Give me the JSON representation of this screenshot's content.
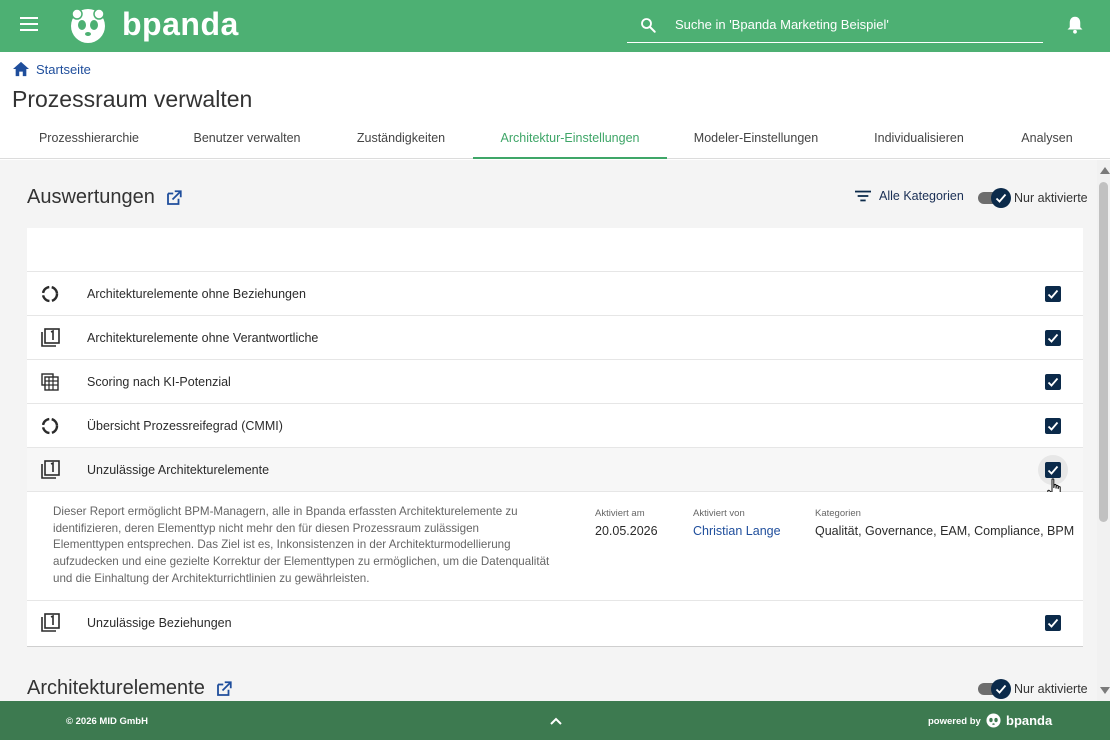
{
  "header": {
    "logo_text": "bpanda",
    "search_placeholder": "Suche in 'Bpanda Marketing Beispiel'"
  },
  "breadcrumb": {
    "home": "Startseite"
  },
  "page_title": "Prozessraum verwalten",
  "tabs": [
    {
      "label": "Prozesshierarchie"
    },
    {
      "label": "Benutzer verwalten"
    },
    {
      "label": "Zuständigkeiten"
    },
    {
      "label": "Architektur-Einstellungen",
      "active": true
    },
    {
      "label": "Modeler-Einstellungen"
    },
    {
      "label": "Individualisieren"
    },
    {
      "label": "Analysen"
    }
  ],
  "auswertungen": {
    "title": "Auswertungen",
    "filter_label": "Alle Kategorien",
    "toggle_label": "Nur aktivierte",
    "rows": [
      {
        "label": "Architekturelemente ohne Beziehungen",
        "icon": "donut-chart-icon",
        "checked": true
      },
      {
        "label": "Architekturelemente ohne Verantwortliche",
        "icon": "report-list-icon",
        "checked": true
      },
      {
        "label": "Scoring nach KI-Potenzial",
        "icon": "table-grid-icon",
        "checked": true
      },
      {
        "label": "Übersicht Prozessreifegrad (CMMI)",
        "icon": "donut-chart-icon",
        "checked": true
      },
      {
        "label": "Unzulässige Architekturelemente",
        "icon": "report-list-icon",
        "checked": true
      }
    ],
    "detail": {
      "description": "Dieser Report ermöglicht BPM-Managern, alle in Bpanda erfassten Architekturelemente zu identifizieren, deren Elementtyp nicht mehr den für diesen Prozessraum zulässigen Elementtypen entsprechen. Das Ziel ist es, Inkonsistenzen in der Architekturmodellierung aufzudecken und eine gezielte Korrektur der Elementtypen zu ermöglichen, um die Datenqualität und die Einhaltung der Architekturrichtlinien zu gewährleisten.",
      "activated_on_label": "Aktiviert am",
      "activated_on": "20.05.2026",
      "activated_by_label": "Aktiviert von",
      "activated_by": "Christian Lange",
      "categories_label": "Kategorien",
      "categories": "Qualität, Governance, EAM, Compliance, BPM"
    },
    "last_row": {
      "label": "Unzulässige Beziehungen",
      "icon": "report-list-icon",
      "checked": true
    }
  },
  "architekturelemente": {
    "title": "Architekturelemente",
    "toggle_label": "Nur aktivierte"
  },
  "footer": {
    "copyright": "© 2026 MID GmbH",
    "powered_by": "powered by",
    "brand": "bpanda"
  },
  "colors": {
    "header_green": "#4db073",
    "footer_green": "#3d7a50",
    "accent_green": "#3fa668",
    "navy": "#0b2a4a",
    "link_blue": "#1f4e9c"
  }
}
